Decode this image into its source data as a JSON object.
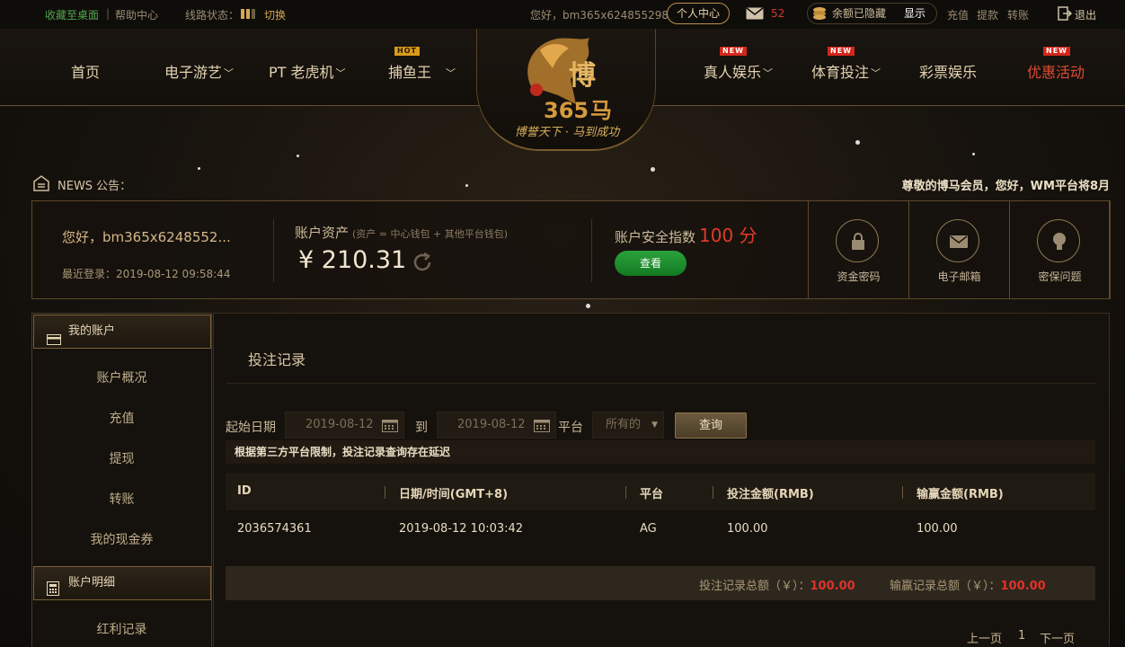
{
  "topbar": {
    "bookmark": "收藏至桌面",
    "help": "帮助中心",
    "line_status_label": "线路状态：",
    "switch": "切换",
    "greeting": "您好，bm365x624855298",
    "profile_btn": "个人中心",
    "mail_count": "52",
    "balance_hidden": "余额已隐藏",
    "show": "显示",
    "deposit": "充值",
    "withdraw": "提款",
    "transfer": "转账",
    "logout": "退出"
  },
  "nav": {
    "home": "首页",
    "egames": "电子游艺",
    "pt": "PT 老虎机",
    "fishing": "捕鱼王",
    "live": "真人娱乐",
    "sports": "体育投注",
    "lottery": "彩票娱乐",
    "promo": "优惠活动",
    "badge_hot": "HOT",
    "badge_new": "NEW",
    "slogan": "博誉天下 · 马到成功"
  },
  "news": {
    "label": "NEWS 公告：",
    "text": "尊敬的博马会员，您好，WM平台将8月"
  },
  "account": {
    "name": "您好，bm365x6248552...",
    "last_login": "最近登录：2019-08-12 09:58:44",
    "assets_label": "账户资产",
    "assets_note": "(资产 = 中心钱包 + 其他平台钱包)",
    "assets_value": "¥ 210.31",
    "security_label": "账户安全指数",
    "security_value": "100 分",
    "check_btn": "查看",
    "sec_password": "资金密码",
    "sec_email": "电子邮箱",
    "sec_question": "密保问题"
  },
  "sidebar": {
    "section1": "我的账户",
    "items1": [
      "账户概况",
      "充值",
      "提现",
      "转账",
      "我的现金券"
    ],
    "section2": "账户明细",
    "items2": [
      "红利记录"
    ]
  },
  "main": {
    "title": "投注记录",
    "start_label": "起始日期",
    "start_date": "2019-08-12",
    "to_label": "到",
    "end_date": "2019-08-12",
    "platform_label": "平台",
    "platform_value": "所有的",
    "query_btn": "查询",
    "notice": "根据第三方平台限制，投注记录查询存在延迟",
    "columns": [
      "ID",
      "日期/时间(GMT+8)",
      "平台",
      "投注金额(RMB)",
      "输赢金额(RMB)"
    ],
    "rows": [
      [
        "2036574361",
        "2019-08-12 10:03:42",
        "AG",
        "100.00",
        "100.00"
      ]
    ],
    "total_bet_label": "投注记录总额（￥）：",
    "total_bet_value": "100.00",
    "total_win_label": "输赢记录总额（￥）：",
    "total_win_value": "100.00",
    "prev": "上一页",
    "page": "1",
    "next": "下一页"
  },
  "colors": {
    "accent_gold": "#d6a650",
    "accent_red": "#e0332a",
    "button_green": "#2aa23a"
  }
}
